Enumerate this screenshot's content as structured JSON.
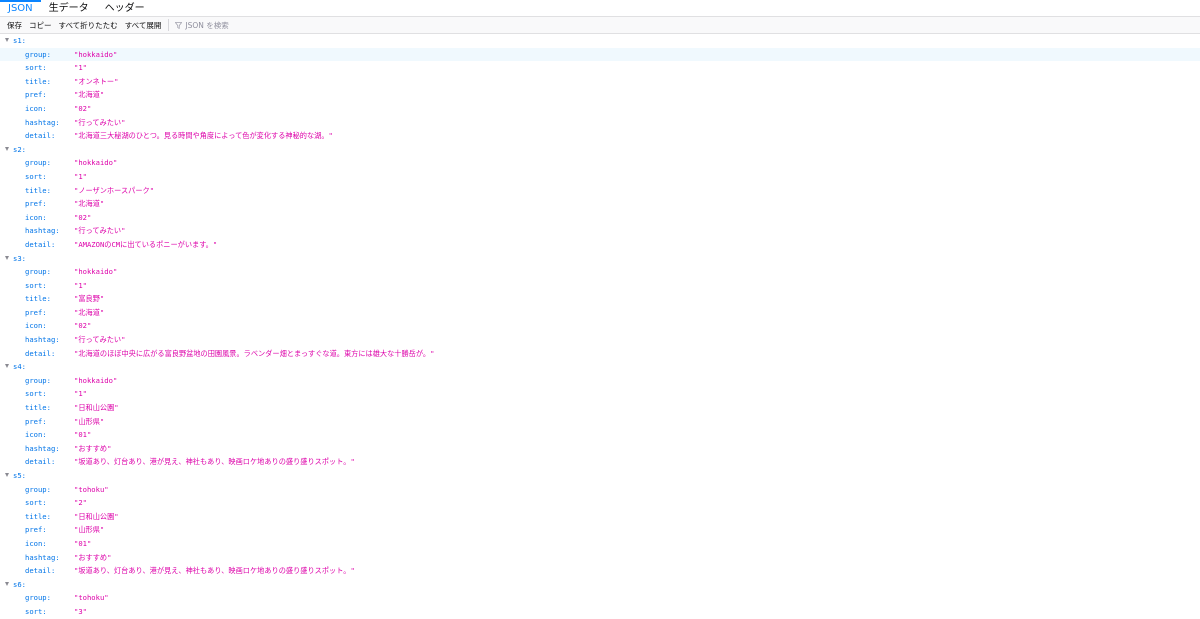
{
  "tabs": [
    {
      "label": "JSON",
      "active": true
    },
    {
      "label": "生データ",
      "active": false
    },
    {
      "label": "ヘッダー",
      "active": false
    }
  ],
  "toolbar": {
    "save": "保存",
    "copy": "コピー",
    "collapse_all": "すべて折りたたむ",
    "expand_all": "すべて展開",
    "filter_placeholder": "JSON を検索"
  },
  "colors": {
    "accent": "#0a84ff",
    "key": "#0074e8",
    "string": "#dd00a9"
  },
  "items": [
    {
      "key": "s1:",
      "props": [
        {
          "k": "group:",
          "v": "\"hokkaido\""
        },
        {
          "k": "sort:",
          "v": "\"1\""
        },
        {
          "k": "title:",
          "v": "\"オンネトー\""
        },
        {
          "k": "pref:",
          "v": "\"北海道\""
        },
        {
          "k": "icon:",
          "v": "\"02\""
        },
        {
          "k": "hashtag:",
          "v": "\"行ってみたい\""
        },
        {
          "k": "detail:",
          "v": "\"北海道三大秘湖のひとつ。見る時間や角度によって色が変化する神秘的な湖。\""
        }
      ]
    },
    {
      "key": "s2:",
      "props": [
        {
          "k": "group:",
          "v": "\"hokkaido\""
        },
        {
          "k": "sort:",
          "v": "\"1\""
        },
        {
          "k": "title:",
          "v": "\"ノーザンホースパーク\""
        },
        {
          "k": "pref:",
          "v": "\"北海道\""
        },
        {
          "k": "icon:",
          "v": "\"02\""
        },
        {
          "k": "hashtag:",
          "v": "\"行ってみたい\""
        },
        {
          "k": "detail:",
          "v": "\"AMAZONのCMに出ているポニーがいます。\""
        }
      ]
    },
    {
      "key": "s3:",
      "props": [
        {
          "k": "group:",
          "v": "\"hokkaido\""
        },
        {
          "k": "sort:",
          "v": "\"1\""
        },
        {
          "k": "title:",
          "v": "\"富良野\""
        },
        {
          "k": "pref:",
          "v": "\"北海道\""
        },
        {
          "k": "icon:",
          "v": "\"02\""
        },
        {
          "k": "hashtag:",
          "v": "\"行ってみたい\""
        },
        {
          "k": "detail:",
          "v": "\"北海道のほぼ中央に広がる富良野盆地の田園風景。ラベンダー畑とまっすぐな道。東方には雄大な十勝岳が。\""
        }
      ]
    },
    {
      "key": "s4:",
      "props": [
        {
          "k": "group:",
          "v": "\"hokkaido\""
        },
        {
          "k": "sort:",
          "v": "\"1\""
        },
        {
          "k": "title:",
          "v": "\"日和山公園\""
        },
        {
          "k": "pref:",
          "v": "\"山形県\""
        },
        {
          "k": "icon:",
          "v": "\"01\""
        },
        {
          "k": "hashtag:",
          "v": "\"おすすめ\""
        },
        {
          "k": "detail:",
          "v": "\"坂道あり、灯台あり、港が見え、神社もあり、映画ロケ地ありの盛り盛りスポット。\""
        }
      ]
    },
    {
      "key": "s5:",
      "props": [
        {
          "k": "group:",
          "v": "\"tohoku\""
        },
        {
          "k": "sort:",
          "v": "\"2\""
        },
        {
          "k": "title:",
          "v": "\"日和山公園\""
        },
        {
          "k": "pref:",
          "v": "\"山形県\""
        },
        {
          "k": "icon:",
          "v": "\"01\""
        },
        {
          "k": "hashtag:",
          "v": "\"おすすめ\""
        },
        {
          "k": "detail:",
          "v": "\"坂道あり、灯台あり、港が見え、神社もあり、映画ロケ地ありの盛り盛りスポット。\""
        }
      ]
    },
    {
      "key": "s6:",
      "props": [
        {
          "k": "group:",
          "v": "\"tohoku\""
        },
        {
          "k": "sort:",
          "v": "\"3\""
        }
      ]
    }
  ]
}
